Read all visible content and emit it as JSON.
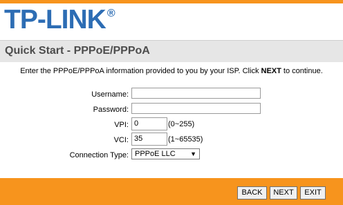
{
  "brand": {
    "logo_text": "TP-LINK",
    "registered_mark": "®",
    "accent_color": "#f7941d",
    "logo_color": "#2d6db4"
  },
  "page": {
    "title": "Quick Start - PPPoE/PPPoA",
    "intro_before": "Enter the PPPoE/PPPoA information provided to you by your ISP. Click ",
    "intro_bold": "NEXT",
    "intro_after": " to continue."
  },
  "form": {
    "username": {
      "label": "Username:",
      "value": ""
    },
    "password": {
      "label": "Password:",
      "value": ""
    },
    "vpi": {
      "label": "VPI:",
      "value": "0",
      "range": "(0~255)"
    },
    "vci": {
      "label": "VCI:",
      "value": "35",
      "range": "(1~65535)"
    },
    "connection_type": {
      "label": "Connection Type:",
      "selected": "PPPoE LLC"
    }
  },
  "buttons": {
    "back": "BACK",
    "next": "NEXT",
    "exit": "EXIT"
  }
}
